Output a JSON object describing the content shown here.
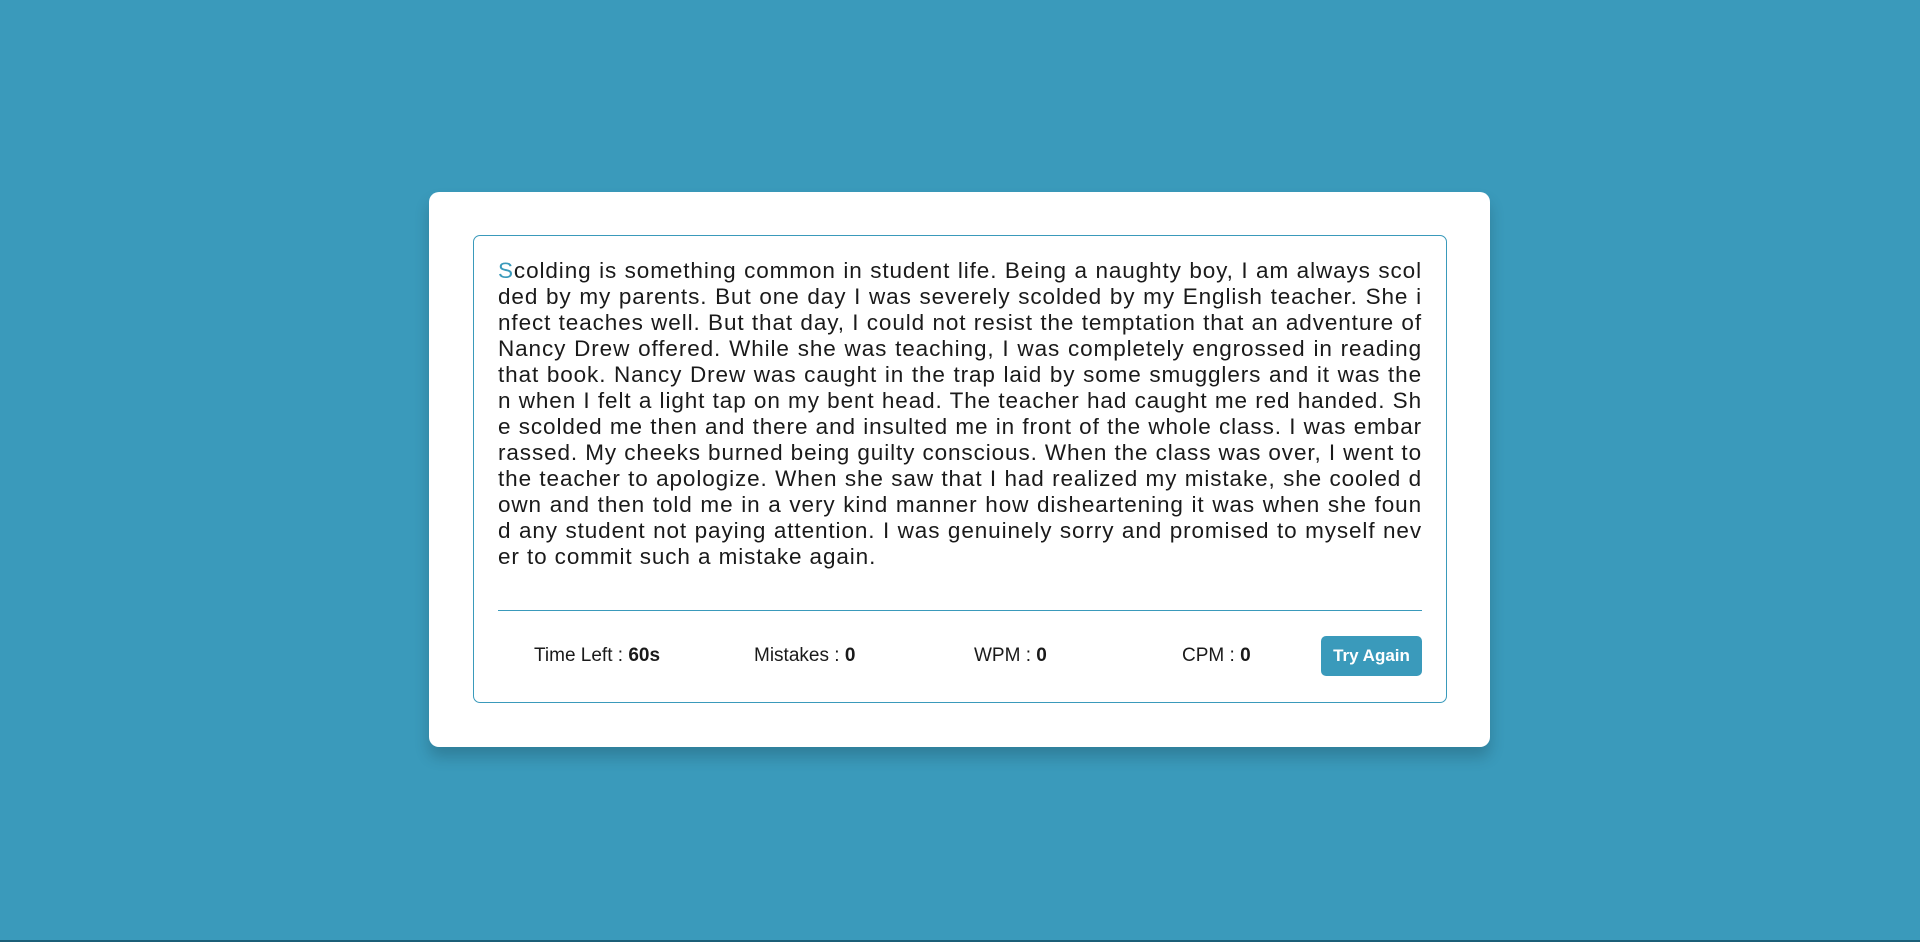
{
  "paragraph": {
    "first_char": "S",
    "rest": "colding is something common in student life. Being a naughty boy, I am always scolded by my parents. But one day I was severely scolded by my English teacher. She infect teaches well. But that day, I could not resist the temptation that an adventure of Nancy Drew offered. While she was teaching, I was completely engrossed in reading that book. Nancy Drew was caught in the trap laid by some smugglers and it was then when I felt a light tap on my bent head. The teacher had caught me red handed. She scolded me then and there and insulted me in front of the whole class. I was embarrassed. My cheeks burned being guilty conscious. When the class was over, I went to the teacher to apologize. When she saw that I had realized my mistake, she cooled down and then told me in a very kind manner how disheartening it was when she found any student not paying attention. I was genuinely sorry and promised to myself never to commit such a mistake again."
  },
  "stats": {
    "time_label": "Time Left :",
    "time_value": "60s",
    "mistakes_label": "Mistakes :",
    "mistakes_value": "0",
    "wpm_label": "WPM :",
    "wpm_value": "0",
    "cpm_label": "CPM :",
    "cpm_value": "0"
  },
  "actions": {
    "try_again_label": "Try Again"
  },
  "colors": {
    "background": "#3a9abb",
    "accent": "#3a9abb",
    "card": "#ffffff",
    "text": "#1a1a1a"
  }
}
